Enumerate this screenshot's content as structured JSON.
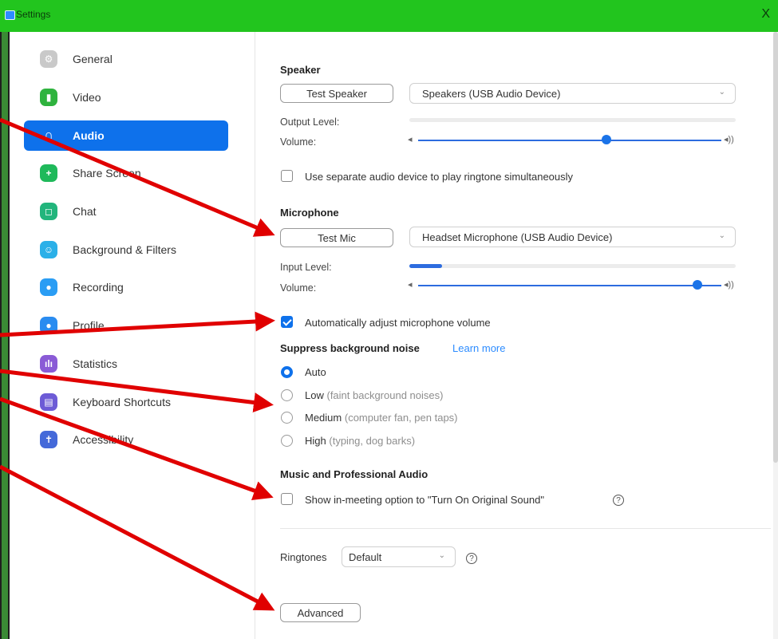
{
  "window": {
    "title": "Settings",
    "close_label": "X"
  },
  "sidebar": {
    "items": [
      {
        "label": "General",
        "icon": "gear-icon",
        "color": "#9e9e9e",
        "active": false
      },
      {
        "label": "Video",
        "icon": "video-camera-icon",
        "color": "#2fb33e",
        "active": false
      },
      {
        "label": "Audio",
        "icon": "headphones-icon",
        "color": "#0e71eb",
        "active": true
      },
      {
        "label": "Share Screen",
        "icon": "share-screen-icon",
        "color": "#1fb95a",
        "active": false
      },
      {
        "label": "Chat",
        "icon": "chat-bubble-icon",
        "color": "#22b57c",
        "active": false
      },
      {
        "label": "Background & Filters",
        "icon": "background-icon",
        "color": "#2bb0e8",
        "active": false
      },
      {
        "label": "Recording",
        "icon": "record-icon",
        "color": "#2a9df4",
        "active": false
      },
      {
        "label": "Profile",
        "icon": "profile-icon",
        "color": "#2a8cf0",
        "active": false
      },
      {
        "label": "Statistics",
        "icon": "statistics-icon",
        "color": "#8a5bd6",
        "active": false
      },
      {
        "label": "Keyboard Shortcuts",
        "icon": "keyboard-icon",
        "color": "#6d5bd6",
        "active": false
      },
      {
        "label": "Accessibility",
        "icon": "accessibility-icon",
        "color": "#4469d9",
        "active": false
      }
    ]
  },
  "speaker": {
    "title": "Speaker",
    "test_label": "Test Speaker",
    "device": "Speakers (USB Audio Device)",
    "output_level_label": "Output Level:",
    "output_level": 0,
    "volume_label": "Volume:",
    "volume": 0.62
  },
  "ringtone_option": {
    "label": "Use separate audio device to play ringtone simultaneously",
    "checked": false
  },
  "microphone": {
    "title": "Microphone",
    "test_label": "Test Mic",
    "device": "Headset Microphone (USB Audio Device)",
    "input_level_label": "Input Level:",
    "input_level": 0.1,
    "volume_label": "Volume:",
    "volume": 0.92
  },
  "auto_adjust": {
    "label": "Automatically adjust microphone volume",
    "checked": true
  },
  "noise": {
    "title": "Suppress background noise",
    "learn_more": "Learn more",
    "options": [
      {
        "label": "Auto",
        "hint": "",
        "selected": true
      },
      {
        "label": "Low",
        "hint": "(faint background noises)",
        "selected": false
      },
      {
        "label": "Medium",
        "hint": "(computer fan, pen taps)",
        "selected": false
      },
      {
        "label": "High",
        "hint": "(typing, dog barks)",
        "selected": false
      }
    ]
  },
  "music": {
    "title": "Music and Professional Audio",
    "option_label": "Show in-meeting option to \"Turn On Original Sound\"",
    "checked": false
  },
  "ringtones": {
    "label": "Ringtones",
    "value": "Default"
  },
  "advanced_label": "Advanced",
  "colors": {
    "accent": "#0e71eb",
    "titlebar": "#22c51e",
    "annotation_arrow": "#e00000"
  }
}
